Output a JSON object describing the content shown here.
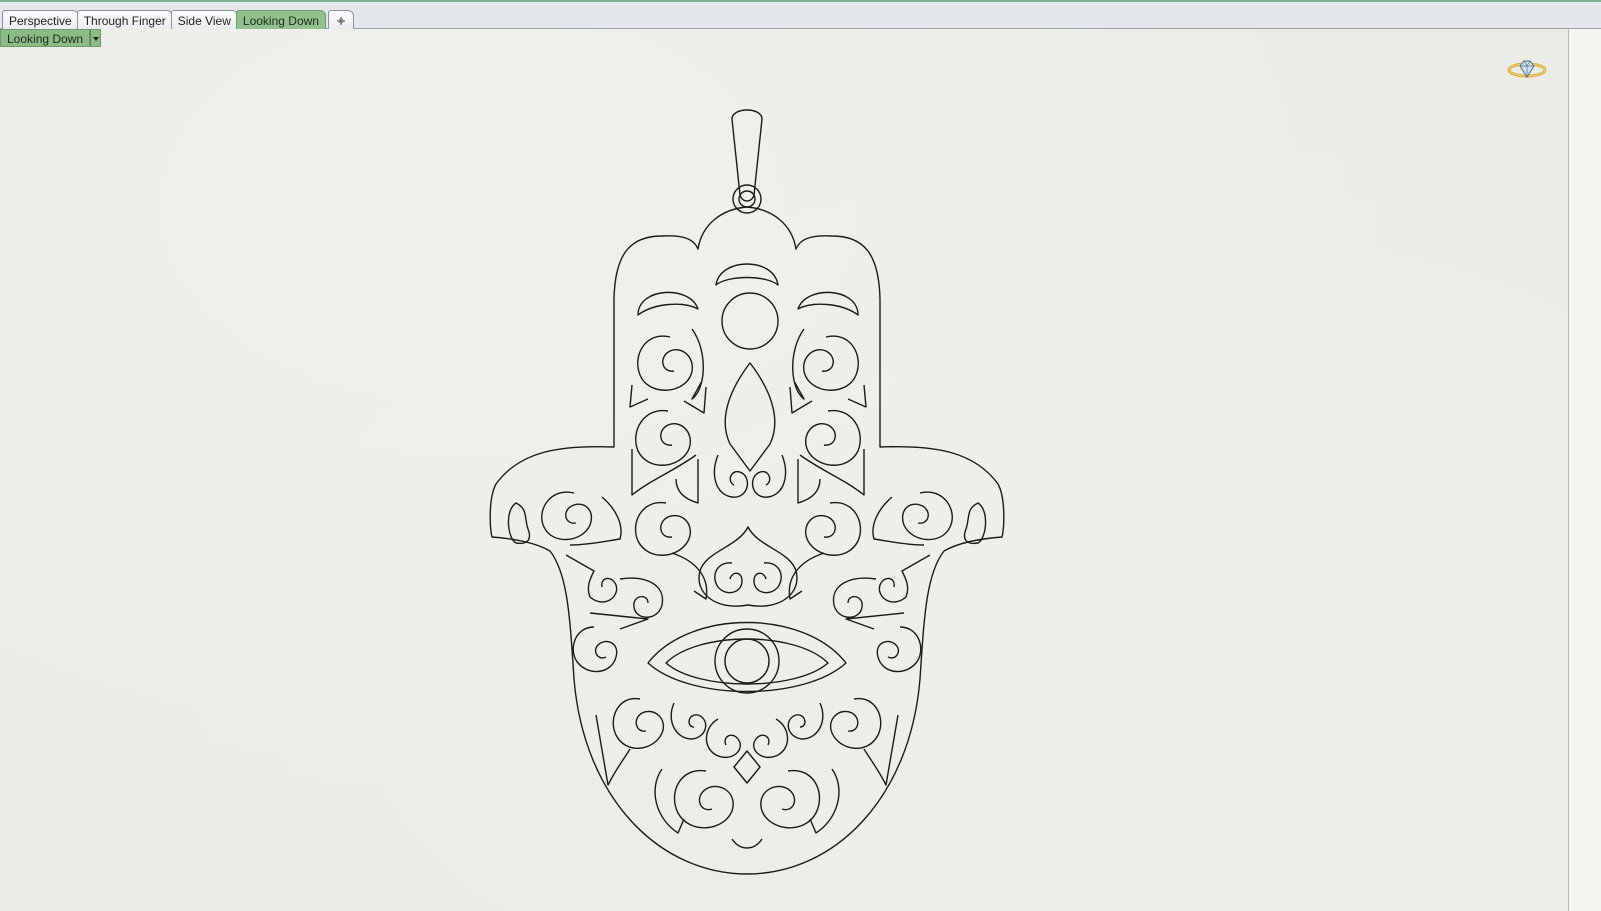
{
  "tabs": [
    {
      "label": "Perspective",
      "active": false
    },
    {
      "label": "Through Finger",
      "active": false
    },
    {
      "label": "Side View",
      "active": false
    },
    {
      "label": "Looking Down",
      "active": true
    }
  ],
  "add_tab_icon": "plus-icon",
  "viewport": {
    "label": "Looking Down",
    "dropdown_icon": "caret-down-icon",
    "corner_icon": "ring-gem-icon",
    "drawing": "hamsa-pendant-wireframe"
  },
  "colors": {
    "active_tab": "#93c18e",
    "viewport_bg": "#ebece6",
    "line": "#1a1a1a"
  }
}
